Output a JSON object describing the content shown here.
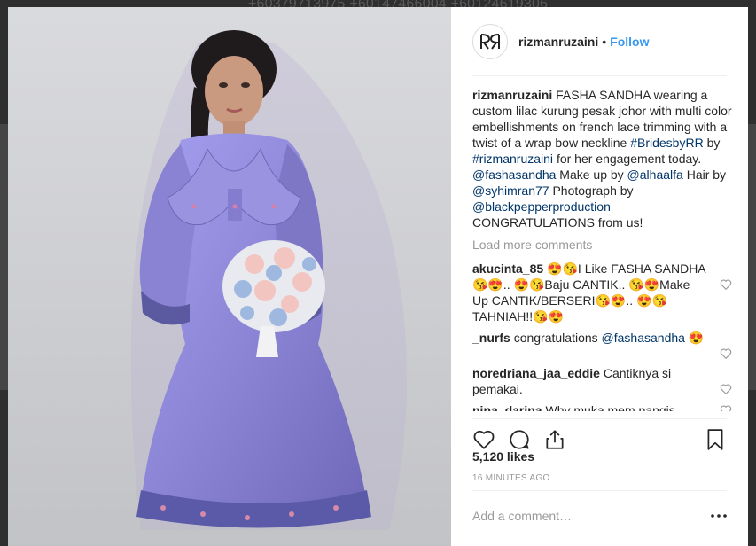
{
  "background": {
    "phone_numbers": "+60379713975 +60147466004 +60124619306"
  },
  "post": {
    "username": "rizmanruzaini",
    "follow_label": "Follow",
    "caption": {
      "user": "rizmanruzaini",
      "text_1": "FASHA SANDHA wearing a custom lilac kurung pesak johor with multi color embellishments on french lace trimming with a twist of a wrap bow neckline",
      "tag_1": "#BridesbyRR",
      "text_2": "by",
      "tag_2": "#rizmanruzaini",
      "text_3": "for her engagement today.",
      "mention_1": "@fashasandha",
      "text_4": "Make up by",
      "mention_2": "@alhaalfa",
      "text_5": "Hair by",
      "mention_3": "@syhimran77",
      "text_6": "Photograph by",
      "mention_4": "@blackpepperproduction",
      "text_7": "CONGRATULATIONS from us!"
    },
    "load_more_label": "Load more comments",
    "comments": [
      {
        "user": "akucinta_85",
        "text": "😍😘I Like FASHA SANDHA😘😍.. 😍😘Baju CANTIK.. 😘😍Make Up CANTIK/BERSERI😘😍.. 😍😘TAHNIAH!!😘😍"
      },
      {
        "user": "_nurfs",
        "text": "congratulations",
        "mention": "@fashasandha",
        "text_after": "😍"
      },
      {
        "user": "noredriana_jaa_eddie",
        "text": "Cantiknya si pemakai."
      },
      {
        "user": "nina_darina",
        "text": "Why muka mem pangis..."
      }
    ],
    "likes": "5,120 likes",
    "timestamp": "16 MINUTES AGO",
    "add_comment_placeholder": "Add a comment…"
  },
  "colors": {
    "link_blue": "#3897f0",
    "tag_navy": "#003569",
    "text": "#262626",
    "muted": "#999999",
    "dress_lilac": "#8c85d6"
  }
}
